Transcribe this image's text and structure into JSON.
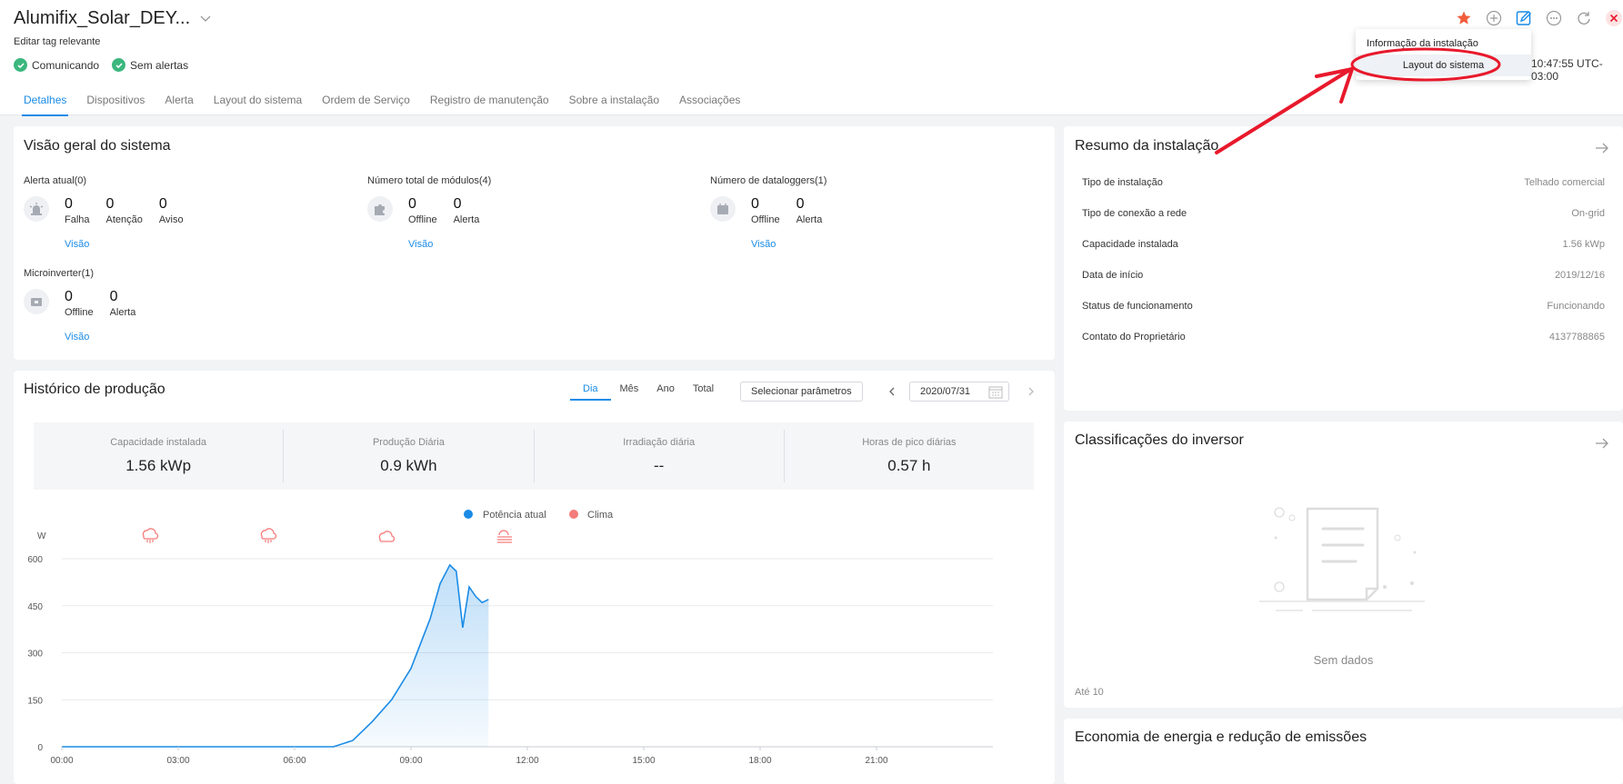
{
  "header": {
    "title": "Alumifix_Solar_DEY...",
    "subtitle": "Editar tag relevante",
    "status_communicating": "Comunicando",
    "status_alerts": "Sem alertas",
    "time": "10:47:55 UTC-03:00"
  },
  "dropdown": {
    "item1": "Informação da instalação",
    "item2": "Layout do sistema"
  },
  "tabs": [
    "Detalhes",
    "Dispositivos",
    "Alerta",
    "Layout do sistema",
    "Ordem de Serviço",
    "Registro de manutenção",
    "Sobre a instalação",
    "Associações"
  ],
  "overview": {
    "title": "Visão geral do sistema",
    "alert_label": "Alerta atual(0)",
    "alert_values": [
      "0",
      "0",
      "0"
    ],
    "alert_labels": [
      "Falha",
      "Atenção",
      "Aviso"
    ],
    "modules_label": "Número total de módulos(4)",
    "modules_values": [
      "0",
      "0"
    ],
    "modules_labels": [
      "Offline",
      "Alerta"
    ],
    "dataloggers_label": "Número de dataloggers(1)",
    "dataloggers_values": [
      "0",
      "0"
    ],
    "dataloggers_labels": [
      "Offline",
      "Alerta"
    ],
    "micro_label": "Microinverter(1)",
    "micro_values": [
      "0",
      "0"
    ],
    "micro_labels": [
      "Offline",
      "Alerta"
    ],
    "view_link": "Visão"
  },
  "summary": {
    "title": "Resumo da instalação",
    "rows": [
      {
        "label": "Tipo de instalação",
        "value": "Telhado comercial"
      },
      {
        "label": "Tipo de conexão a rede",
        "value": "On-grid"
      },
      {
        "label": "Capacidade instalada",
        "value": "1.56 kWp"
      },
      {
        "label": "Data de início",
        "value": "2019/12/16"
      },
      {
        "label": "Status de funcionamento",
        "value": "Funcionando"
      },
      {
        "label": "Contato do Proprietário",
        "value": "4137788865"
      }
    ]
  },
  "history": {
    "title": "Histórico de produção",
    "periods": [
      "Dia",
      "Mês",
      "Ano",
      "Total"
    ],
    "select_params": "Selecionar parâmetros",
    "date": "2020/07/31",
    "kpis": [
      {
        "label": "Capacidade instalada",
        "value": "1.56 kWp"
      },
      {
        "label": "Produção Diária",
        "value": "0.9 kWh"
      },
      {
        "label": "Irradiação diária",
        "value": "--"
      },
      {
        "label": "Horas de pico diárias",
        "value": "0.57 h"
      }
    ],
    "legend": [
      "Potência atual",
      "Clima"
    ],
    "unit": "W"
  },
  "ratings": {
    "title": "Classificações do inversor",
    "empty": "Sem dados",
    "footer": "Até 10"
  },
  "economy": {
    "title": "Economia de energia e redução de emissões"
  },
  "colors": {
    "accent": "#1a8be6",
    "ok": "#3bb77e",
    "weather": "#f47c7c",
    "star": "#f25c3b",
    "arrow": "#e8192c"
  },
  "chart_data": {
    "type": "area",
    "series": [
      {
        "name": "Potência atual",
        "x": [
          "00:00",
          "07:00",
          "07:30",
          "08:00",
          "08:30",
          "09:00",
          "09:15",
          "09:30",
          "09:45",
          "10:00",
          "10:10",
          "10:20",
          "10:30",
          "10:40",
          "10:50",
          "11:00"
        ],
        "values": [
          0,
          0,
          20,
          80,
          150,
          250,
          330,
          410,
          520,
          580,
          560,
          380,
          510,
          480,
          460,
          470
        ]
      }
    ],
    "x_ticks": [
      "00:00",
      "03:00",
      "06:00",
      "09:00",
      "12:00",
      "15:00",
      "18:00",
      "21:00"
    ],
    "y_ticks": [
      0,
      150,
      300,
      450,
      600
    ],
    "ylim": [
      0,
      600
    ],
    "ylabel": "W"
  }
}
